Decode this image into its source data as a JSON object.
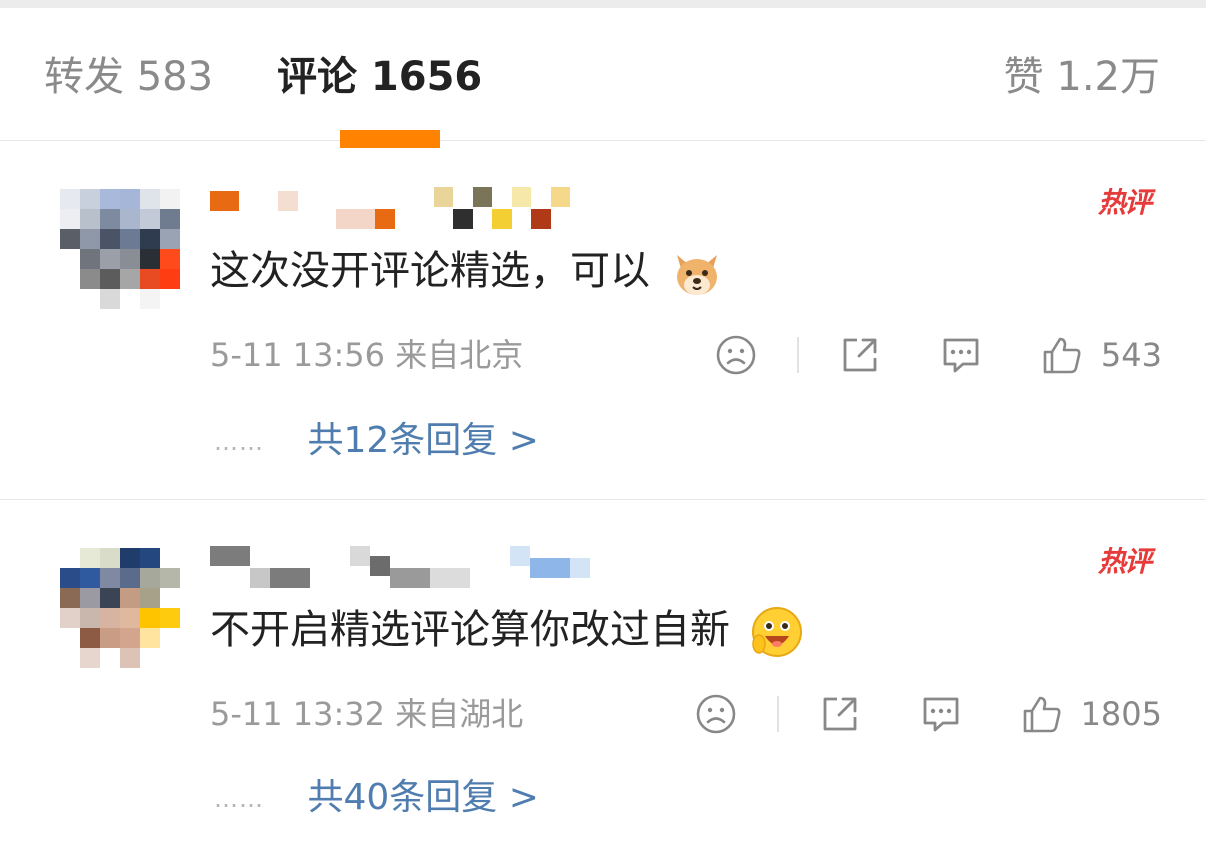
{
  "tabs": {
    "repost": "转发 583",
    "comment": "评论 1656",
    "like": "赞 1.2万",
    "accent_color": "#ff8200"
  },
  "comments": [
    {
      "hot_badge": "热评",
      "text": "这次没开评论精选，可以",
      "emoji": "dog-face-emoji",
      "time": "5-11 13:56",
      "location": "来自北京",
      "likes": "543",
      "replies": "共12条回复 >"
    },
    {
      "hot_badge": "热评",
      "text": "不开启精选评论算你改过自新",
      "emoji": "grinning-face-emoji",
      "time": "5-11 13:32",
      "location": "来自湖北",
      "likes": "1805",
      "replies": "共40条回复 >"
    }
  ],
  "reply_dots": "……",
  "colors": {
    "hot_badge": "#e63b3b",
    "reply_link": "#507daf",
    "meta_gray": "#9a9a9a"
  }
}
